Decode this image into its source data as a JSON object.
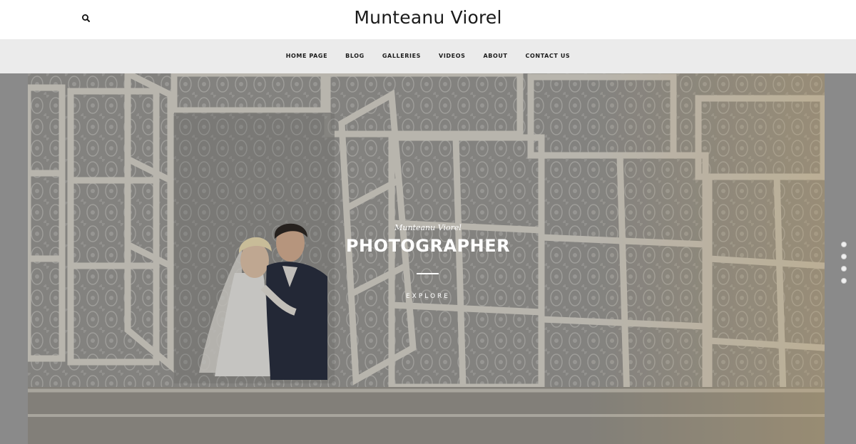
{
  "header": {
    "site_title": "Munteanu Viorel",
    "search_icon": "search-icon"
  },
  "nav": {
    "items": [
      {
        "label": "HOME PAGE"
      },
      {
        "label": "BLOG"
      },
      {
        "label": "GALLERIES"
      },
      {
        "label": "VIDEOS"
      },
      {
        "label": "ABOUT"
      },
      {
        "label": "CONTACT US"
      }
    ]
  },
  "hero": {
    "subtitle": "Munteanu Viorel",
    "title": "PHOTOGRAPHER",
    "cta_label": "EXPLORE",
    "image_description": "couple-at-window-photo"
  },
  "slider": {
    "slide_count": 4,
    "active_index": 0
  },
  "colors": {
    "nav_bg": "#ebebeb",
    "header_bg": "#ffffff",
    "hero_frame": "#8a8a8a",
    "text_light": "#ffffff"
  }
}
